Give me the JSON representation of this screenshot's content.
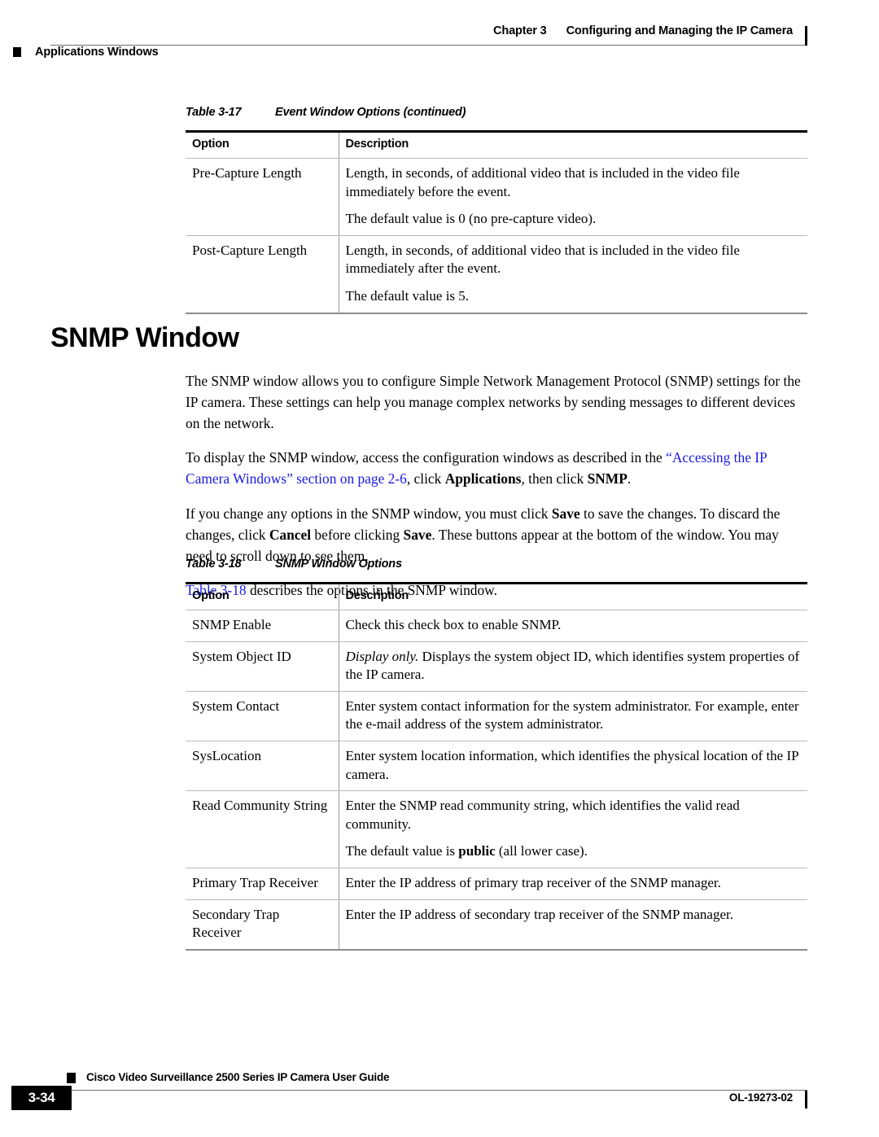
{
  "header": {
    "chapter_label": "Chapter 3",
    "chapter_title": "Configuring and Managing the IP Camera",
    "section_label": "Applications Windows"
  },
  "table_3_17": {
    "caption_number": "Table 3-17",
    "caption_title": "Event Window Options (continued)",
    "columns": [
      "Option",
      "Description"
    ],
    "rows": [
      {
        "option": "Pre-Capture Length",
        "description": [
          "Length, in seconds, of additional video that is included in the video file immediately before the event.",
          "The default value is 0 (no pre-capture video)."
        ]
      },
      {
        "option": "Post-Capture Length",
        "description": [
          "Length, in seconds, of additional video that is included in the video file immediately after the event.",
          "The default value is 5."
        ]
      }
    ]
  },
  "snmp_section": {
    "heading": "SNMP Window",
    "paragraph_1": "The SNMP window allows you to configure Simple Network Management Protocol (SNMP) settings for the IP camera. These settings can help you manage complex networks by sending messages to different devices on the network.",
    "paragraph_2": {
      "text_before_link": "To display the SNMP window, access the configuration windows as described in the ",
      "link_text": "“Accessing the IP Camera Windows” section on page 2-6",
      "text_after_link": ", click ",
      "bold_1": "Applications",
      "text_mid": ", then click ",
      "bold_2": "SNMP",
      "text_end": "."
    },
    "paragraph_3": {
      "part_1": "If you change any options in the SNMP window, you must click ",
      "bold_1": "Save",
      "part_2": " to save the changes. To discard the changes, click ",
      "bold_2": "Cancel",
      "part_3": " before clicking ",
      "bold_3": "Save",
      "part_4": ". These buttons appear at the bottom of the window. You may need to scroll down to see them."
    },
    "paragraph_4": {
      "link_text": "Table 3-18",
      "text_after": " describes the options in the SNMP window."
    }
  },
  "table_3_18": {
    "caption_number": "Table 3-18",
    "caption_title": "SNMP Window Options",
    "columns": [
      "Option",
      "Description"
    ],
    "rows": [
      {
        "option": "SNMP Enable",
        "description": [
          "Check this check box to enable SNMP."
        ]
      },
      {
        "option": "System Object ID",
        "description_italic_lead": "Display only.",
        "description": [
          " Displays the system object ID, which identifies system properties of the IP camera."
        ]
      },
      {
        "option": "System Contact",
        "description": [
          "Enter system contact information for the system administrator. For example, enter the e-mail address of the system administrator."
        ]
      },
      {
        "option": "SysLocation",
        "description": [
          "Enter system location information, which identifies the physical location of the IP camera."
        ]
      },
      {
        "option": "Read Community String",
        "description": [
          "Enter the SNMP read community string, which identifies the valid read community."
        ],
        "description_2_before_bold": "The default value is ",
        "description_2_bold": "public",
        "description_2_after_bold": " (all lower case)."
      },
      {
        "option": "Primary Trap Receiver",
        "description": [
          "Enter the IP address of primary trap receiver of the SNMP manager."
        ]
      },
      {
        "option": "Secondary Trap Receiver",
        "description": [
          "Enter the IP address of secondary trap receiver of the SNMP manager."
        ]
      }
    ]
  },
  "footer": {
    "page_number": "3-34",
    "guide_title": "Cisco Video Surveillance 2500 Series IP Camera User Guide",
    "doc_number": "OL-19273-02"
  },
  "colors": {
    "link": "#1a1ae6",
    "rule": "#6f6f6f",
    "table_border_top": "#000000",
    "table_row_divider": "#b9b9b9"
  }
}
